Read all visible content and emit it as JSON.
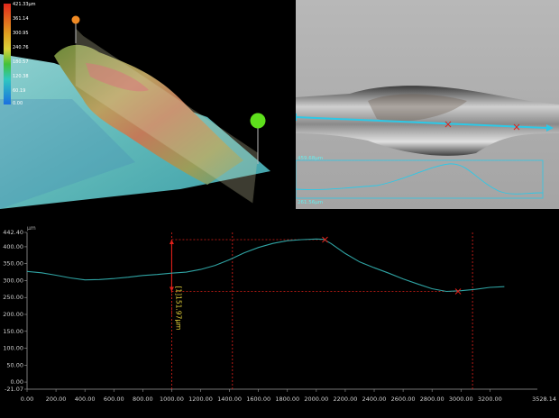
{
  "view3d": {
    "colorbar_labels": [
      "421.33µm",
      "361.14",
      "300.95",
      "240.76",
      "180.57",
      "120.38",
      "60.19",
      "0.00"
    ],
    "colors": {
      "high": "#e0281c",
      "mid": "#dcd23a",
      "low": "#1b6fe0"
    }
  },
  "micro": {
    "scale_top": "459.68µm",
    "scale_bottom": "261.56µm",
    "line_color": "#2ec8e6"
  },
  "profile": {
    "unit": "µm",
    "y_tick_labels": [
      "442.40",
      "400.00",
      "350.00",
      "300.00",
      "250.00",
      "200.00",
      "150.00",
      "100.00",
      "50.00",
      "0.00",
      "-21.07"
    ],
    "x_tick_labels": [
      "0.00",
      "200.00",
      "400.00",
      "600.00",
      "800.00",
      "1000.00",
      "1200.00",
      "1400.00",
      "1600.00",
      "1800.00",
      "2000.00",
      "2200.00",
      "2400.00",
      "2600.00",
      "2800.00",
      "3000.00",
      "3200.00"
    ],
    "x_end_label": "3528.14",
    "measurement": "[1]151.97µm",
    "colors": {
      "curve": "#2fa3a3",
      "marker": "#e0201a",
      "axis": "#9a9a9a",
      "measure_text": "#e6d23a"
    }
  },
  "chart_data": {
    "type": "line",
    "title": "",
    "xlabel": "",
    "ylabel": "µm",
    "xlim": [
      0,
      3528.14
    ],
    "ylim": [
      -21.07,
      442.4
    ],
    "grid": false,
    "series": [
      {
        "x": [
          0,
          100,
          200,
          300,
          400,
          500,
          600,
          700,
          800,
          900,
          1000,
          1100,
          1200,
          1300,
          1400,
          1500,
          1600,
          1700,
          1800,
          1900,
          2000,
          2050,
          2100,
          2200,
          2300,
          2400,
          2500,
          2600,
          2700,
          2800,
          2900,
          3000,
          3100,
          3200,
          3300
        ],
        "values": [
          327,
          323,
          316,
          308,
          302,
          303,
          306,
          310,
          315,
          318,
          322,
          325,
          333,
          345,
          362,
          382,
          398,
          410,
          418,
          421,
          423,
          422,
          410,
          380,
          355,
          338,
          322,
          305,
          290,
          276,
          268,
          270,
          274,
          280,
          282
        ]
      }
    ],
    "markers": [
      {
        "x": 2060,
        "y": 421
      },
      {
        "x": 2980,
        "y": 268
      }
    ],
    "cursor_x": [
      1000,
      1420,
      3080
    ],
    "measurement_value": "151.97"
  }
}
